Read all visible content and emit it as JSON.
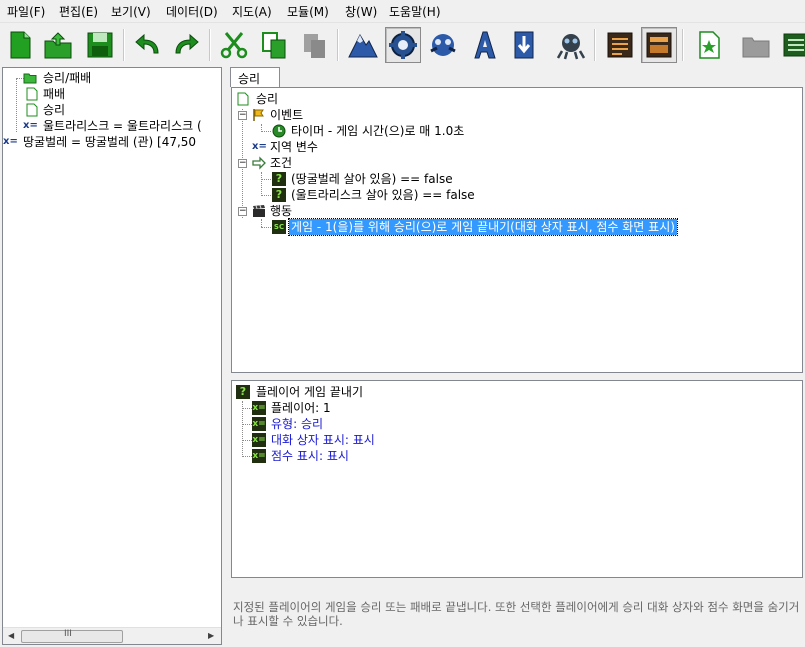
{
  "menu": [
    "파일(F)",
    "편집(E)",
    "보기(V)",
    "데이터(D)",
    "지도(A)",
    "모듈(M)",
    "창(W)",
    "도움말(H)"
  ],
  "left_tree": [
    {
      "label": "승리/패배",
      "icon": "folder-icon"
    },
    {
      "label": "패배",
      "icon": "document-icon"
    },
    {
      "label": "승리",
      "icon": "document-icon"
    },
    {
      "label": "울트라리스크 = 울트라리스크 (",
      "icon": "variable-icon"
    },
    {
      "label": "땅굴벌레 = 땅굴벌레 (관) [47,50",
      "icon": "variable-icon"
    }
  ],
  "tab": {
    "label": "승리"
  },
  "trigger_tree": {
    "root": "승리",
    "events_label": "이벤트",
    "event_item": "타이머 - 게임 시간(으)로 매 1.0초",
    "local_vars_label": "지역 변수",
    "conditions_label": "조건",
    "conditions": [
      "(땅굴벌레 살아 있음) == false",
      "(울트라리스크 살아 있음) == false"
    ],
    "actions_label": "행동",
    "action_item": "게임 - 1(을)를 위해 승리(으)로 게임 끝내기(대화 상자 표시, 점수 화면 표시)"
  },
  "function_panel": {
    "title": "플레이어 게임 끝내기",
    "params": [
      {
        "label": "플레이어: ",
        "value": "1",
        "value_blue": false
      },
      {
        "label": "유형: ",
        "value": "승리",
        "value_blue": true
      },
      {
        "label": "대화 상자 표시: ",
        "value": "표시",
        "value_blue": true
      },
      {
        "label": "점수 표시: ",
        "value": "표시",
        "value_blue": true
      }
    ]
  },
  "description": "지정된 플레이어의 게임을 승리 또는 패배로 끝냅니다. 또한 선택한 플레이어에게 승리 대화 상자와 점수 화면을 숨기거나 표시할 수 있습니다.",
  "scroll_thumb_label": "III",
  "colors": {
    "selection": "#3399ff",
    "param_value": "#1a1ad2",
    "param_icon_bg": "#1f2f10"
  }
}
